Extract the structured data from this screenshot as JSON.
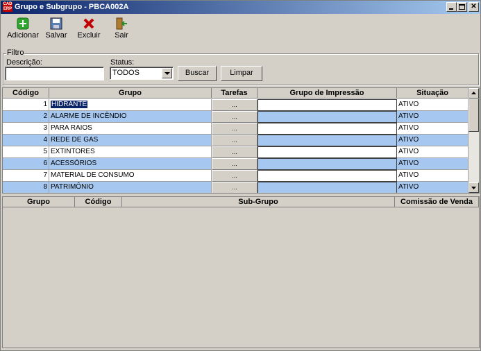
{
  "window": {
    "title": "Grupo e Subgrupo - PBCA002A",
    "app_icon_text": "CAD ERP"
  },
  "toolbar": {
    "add_label": "Adicionar",
    "save_label": "Salvar",
    "delete_label": "Excluir",
    "exit_label": "Sair"
  },
  "filter": {
    "legend": "Filtro",
    "description_label": "Descrição:",
    "description_value": "",
    "status_label": "Status:",
    "status_value": "TODOS",
    "search_label": "Buscar",
    "clear_label": "Limpar"
  },
  "groups_table": {
    "columns": [
      "Código",
      "Grupo",
      "Tarefas",
      "Grupo de Impressão",
      "Situação"
    ],
    "rows": [
      {
        "codigo": "1",
        "grupo": "HIDRANTE",
        "tarefas": "...",
        "impressao": "",
        "situacao": "ATIVO"
      },
      {
        "codigo": "2",
        "grupo": "ALARME DE INCÊNDIO",
        "tarefas": "...",
        "impressao": "",
        "situacao": "ATIVO"
      },
      {
        "codigo": "3",
        "grupo": "PARA RAIOS",
        "tarefas": "...",
        "impressao": "",
        "situacao": "ATIVO"
      },
      {
        "codigo": "4",
        "grupo": "REDE DE GAS",
        "tarefas": "...",
        "impressao": "",
        "situacao": "ATIVO"
      },
      {
        "codigo": "5",
        "grupo": "EXTINTORES",
        "tarefas": "...",
        "impressao": "",
        "situacao": "ATIVO"
      },
      {
        "codigo": "6",
        "grupo": "ACESSÓRIOS",
        "tarefas": "...",
        "impressao": "",
        "situacao": "ATIVO"
      },
      {
        "codigo": "7",
        "grupo": "MATERIAL DE CONSUMO",
        "tarefas": "...",
        "impressao": "",
        "situacao": "ATIVO"
      },
      {
        "codigo": "8",
        "grupo": "PATRIMÔNIO",
        "tarefas": "...",
        "impressao": "",
        "situacao": "ATIVO"
      }
    ]
  },
  "subgroups_table": {
    "columns": [
      "Grupo",
      "Código",
      "Sub-Grupo",
      "Comissão de Venda"
    ]
  },
  "colors": {
    "row_alt": "#a6c8f0",
    "selection": "#0a246a",
    "title_start": "#0a246a",
    "title_end": "#a6caf0"
  }
}
